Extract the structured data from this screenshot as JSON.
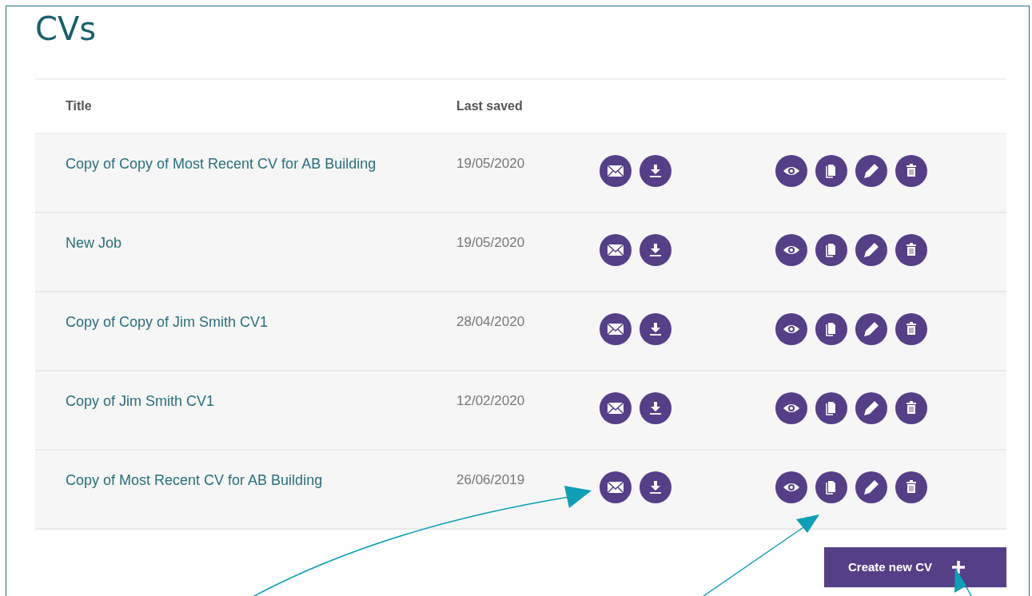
{
  "page_title": "CVs",
  "table": {
    "columns": [
      "Title",
      "Last saved"
    ],
    "rows": [
      {
        "title": "Copy of Copy of Most Recent CV for AB Building",
        "last_saved": "19/05/2020"
      },
      {
        "title": "New Job",
        "last_saved": "19/05/2020"
      },
      {
        "title": "Copy of Copy of Jim Smith CV1",
        "last_saved": "28/04/2020"
      },
      {
        "title": "Copy of Jim Smith CV1",
        "last_saved": "12/02/2020"
      },
      {
        "title": "Copy of Most Recent CV for AB Building",
        "last_saved": "26/06/2019"
      }
    ]
  },
  "create_button": {
    "label": "Create new CV"
  }
}
